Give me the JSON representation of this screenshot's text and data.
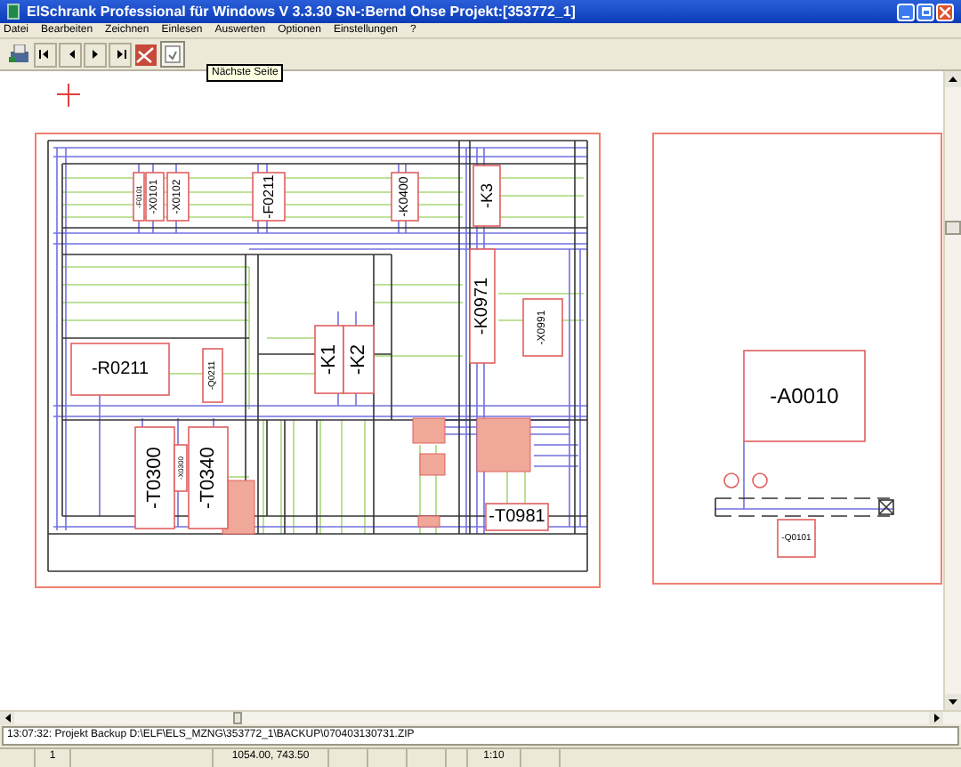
{
  "window": {
    "title": "ElSchrank Professional für Windows  V 3.3.30 SN-:Bernd Ohse Projekt:[353772_1]"
  },
  "menu": [
    {
      "label": "Datei"
    },
    {
      "label": "Bearbeiten"
    },
    {
      "label": "Zeichnen"
    },
    {
      "label": "Einlesen"
    },
    {
      "label": "Auswerten"
    },
    {
      "label": "Optionen"
    },
    {
      "label": "Einstellungen"
    },
    {
      "label": "?"
    }
  ],
  "toolbar": {
    "tooltip": "Nächste Seite"
  },
  "drawing": {
    "components": [
      {
        "label": "-F0101",
        "kind": "vertical"
      },
      {
        "label": "-X0101",
        "kind": "vertical"
      },
      {
        "label": "-X0102",
        "kind": "vertical"
      },
      {
        "label": "-F0211",
        "kind": "vertical"
      },
      {
        "label": "-K0400",
        "kind": "vertical"
      },
      {
        "label": "-K3",
        "kind": "vertical"
      },
      {
        "label": "-K0971",
        "kind": "vertical"
      },
      {
        "label": "-X0991",
        "kind": "vertical"
      },
      {
        "label": "-R0211",
        "kind": "horizontal"
      },
      {
        "label": "-Q0211",
        "kind": "vertical"
      },
      {
        "label": "-K1",
        "kind": "vertical"
      },
      {
        "label": "-K2",
        "kind": "vertical"
      },
      {
        "label": "-T0300",
        "kind": "vertical"
      },
      {
        "label": "-X0300",
        "kind": "vertical"
      },
      {
        "label": "-T0340",
        "kind": "vertical"
      },
      {
        "label": "-T0981",
        "kind": "horizontal"
      },
      {
        "label": "-A0010",
        "kind": "horizontal"
      },
      {
        "label": "-Q0101",
        "kind": "horizontal"
      }
    ]
  },
  "log": {
    "message": "13:07:32: Projekt Backup D:\\ELF\\ELS_MZNG\\353772_1\\BACKUP\\070403130731.ZIP"
  },
  "status_bar": {
    "page": "1",
    "coordinates": "1054.00, 743.50",
    "scale": "1:10"
  }
}
